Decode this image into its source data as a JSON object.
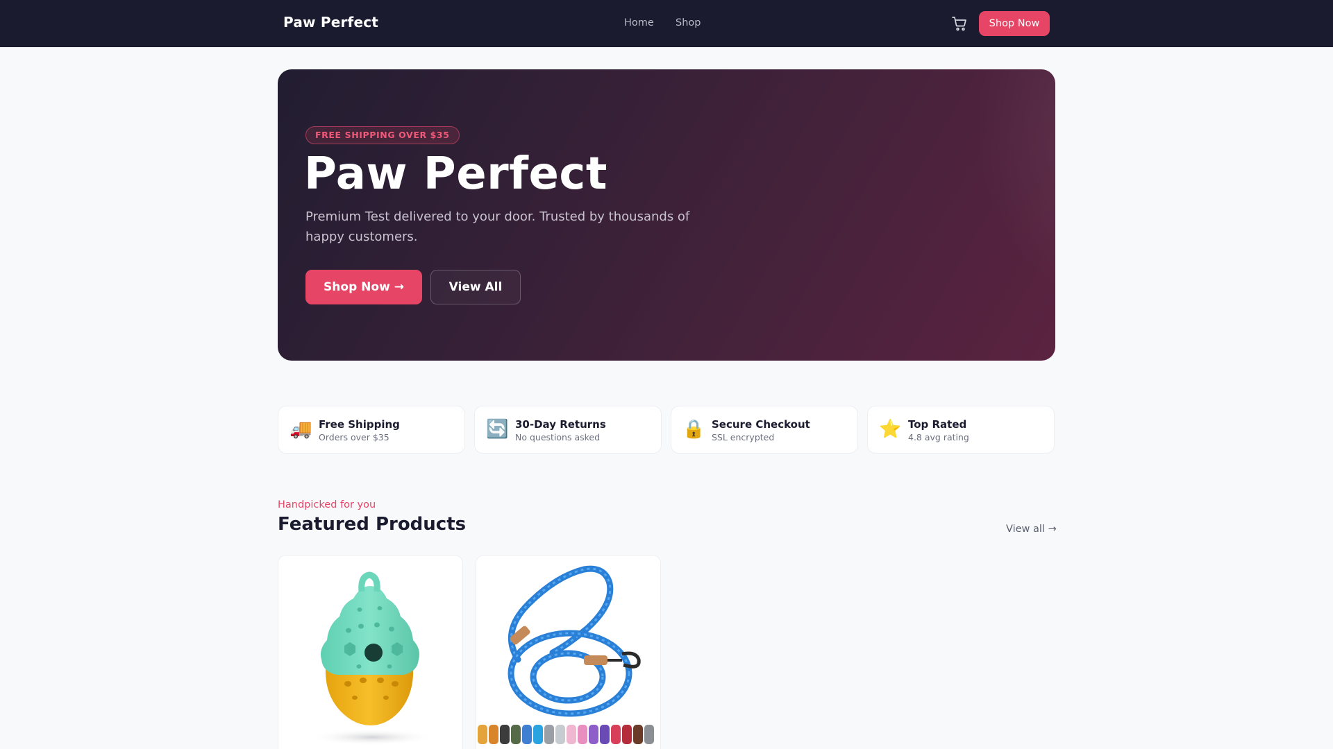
{
  "nav": {
    "brand": "Paw Perfect",
    "links": [
      "Home",
      "Shop"
    ],
    "cart_icon": "cart-icon",
    "cta_label": "Shop Now"
  },
  "hero": {
    "badge": "FREE SHIPPING OVER $35",
    "title": "Paw Perfect",
    "subtitle": "Premium Test delivered to your door. Trusted by thousands of happy customers.",
    "primary_label": "Shop Now →",
    "secondary_label": "View All"
  },
  "features": [
    {
      "icon": "🚚",
      "icon_name": "delivery-truck-icon",
      "title": "Free Shipping",
      "subtitle": "Orders over $35"
    },
    {
      "icon": "🔄",
      "icon_name": "returns-arrows-icon",
      "title": "30-Day Returns",
      "subtitle": "No questions asked"
    },
    {
      "icon": "🔒",
      "icon_name": "lock-icon",
      "title": "Secure Checkout",
      "subtitle": "SSL encrypted"
    },
    {
      "icon": "⭐",
      "icon_name": "star-icon",
      "title": "Top Rated",
      "subtitle": "4.8 avg rating"
    }
  ],
  "featured": {
    "eyebrow": "Handpicked for you",
    "title": "Featured Products",
    "view_all": "View all →",
    "products": [
      {
        "image": "treat-dispenser-toy"
      },
      {
        "image": "rope-leash"
      }
    ]
  },
  "colors": {
    "accent": "#e64566",
    "nav_bg": "#1b1b2f",
    "page_bg": "#f8f9fb"
  }
}
